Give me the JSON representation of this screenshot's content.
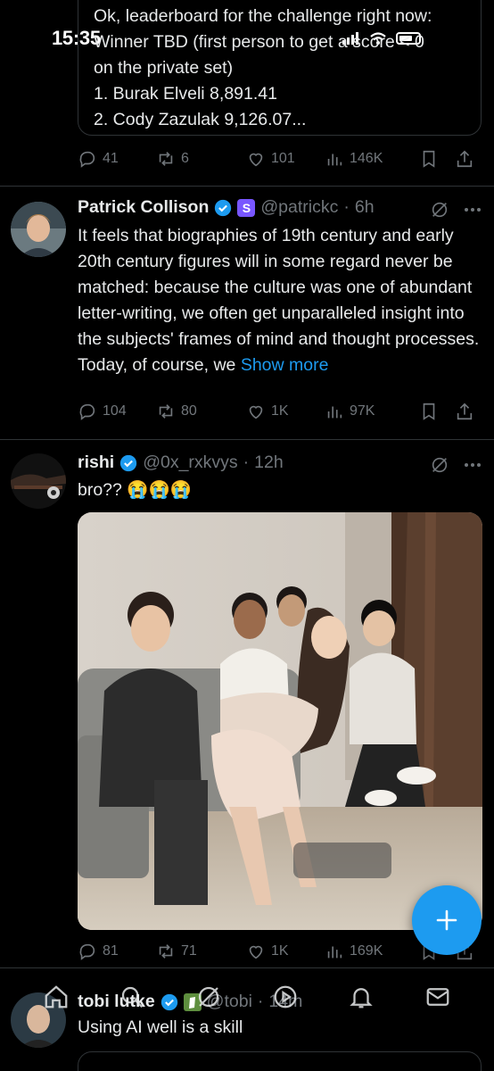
{
  "status_bar": {
    "time": "15:35"
  },
  "quoted_tweet": {
    "text": "Ok, leaderboard for the challenge right now:\nWinner TBD (first person to get a score < 0\non the private set)\n1. Burak Elveli 8,891.41\n2. Cody Zazulak 9,126.07..."
  },
  "tweets": [
    {
      "name": "",
      "handle": "",
      "actions": {
        "replies": "41",
        "reposts": "6",
        "likes": "101",
        "views": "146K"
      }
    },
    {
      "name": "Patrick Collison",
      "badge_letter": "S",
      "handle": "@patrickc",
      "time": "6h",
      "text": "It feels that biographies of 19th century and early 20th century figures will in some regard never be matched: because the culture was one of abundant letter-writing, we often get unparalleled insight into the subjects' frames of mind and thought processes. Today, of course, we",
      "show_more": "Show more",
      "actions": {
        "replies": "104",
        "reposts": "80",
        "likes": "1K",
        "views": "97K"
      }
    },
    {
      "name": "rishi",
      "handle": "@0x_rxkvys",
      "time": "12h",
      "text": "bro?? 😭😭😭",
      "actions": {
        "replies": "81",
        "reposts": "71",
        "likes": "1K",
        "views": "169K"
      }
    },
    {
      "name": "tobi lutke",
      "handle": "@tobi",
      "time": "14m",
      "text": "Using AI well is a skill"
    }
  ],
  "colors": {
    "accent": "#1d9bf0",
    "muted": "#71767b",
    "text": "#e7e9ea",
    "divider": "#2f3336",
    "badge": "#7856ff"
  }
}
